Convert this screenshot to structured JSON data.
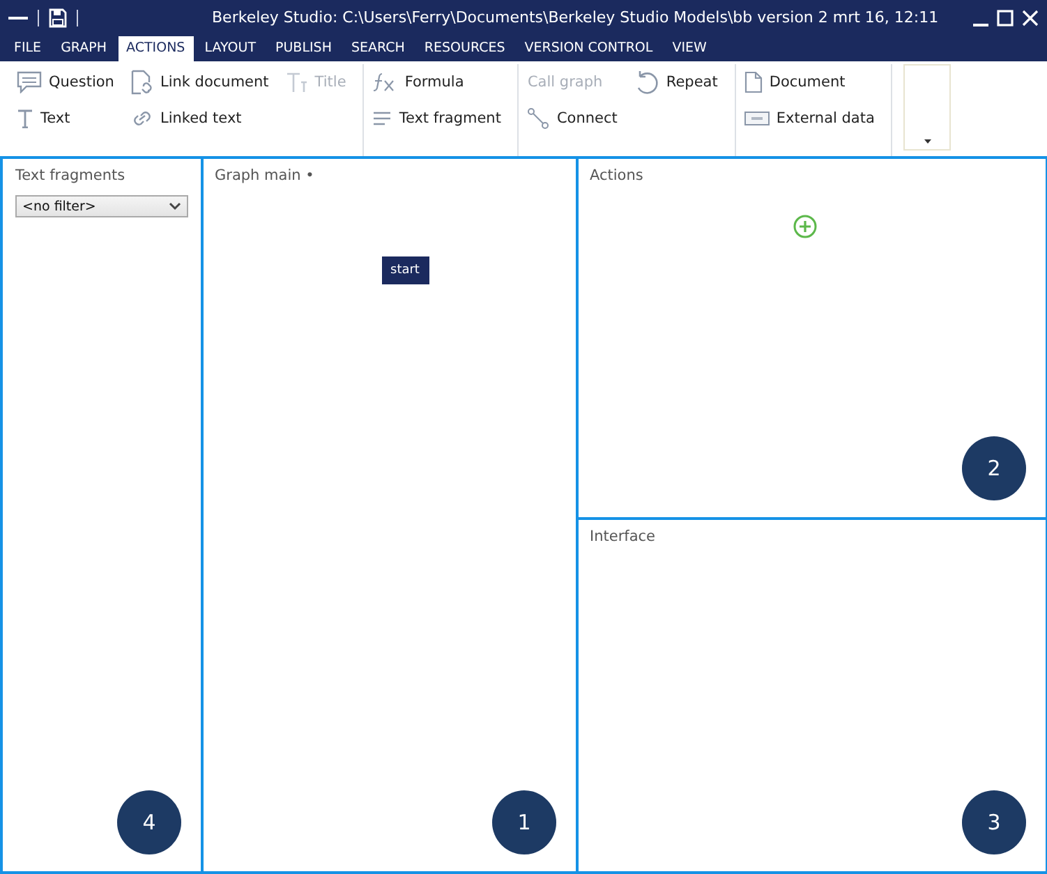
{
  "window": {
    "title": "Berkeley Studio: C:\\Users\\Ferry\\Documents\\Berkeley Studio Models\\bb version 2 mrt 16, 12:11"
  },
  "tabs": [
    {
      "label": "FILE",
      "selected": false
    },
    {
      "label": "GRAPH",
      "selected": false
    },
    {
      "label": "ACTIONS",
      "selected": true
    },
    {
      "label": "LAYOUT",
      "selected": false
    },
    {
      "label": "PUBLISH",
      "selected": false
    },
    {
      "label": "SEARCH",
      "selected": false
    },
    {
      "label": "RESOURCES",
      "selected": false
    },
    {
      "label": "VERSION CONTROL",
      "selected": false
    },
    {
      "label": "VIEW",
      "selected": false
    }
  ],
  "ribbon": {
    "groups": [
      {
        "rows": [
          [
            {
              "label": "Question",
              "disabled": false
            },
            {
              "label": "Link document",
              "disabled": false
            },
            {
              "label": "Title",
              "disabled": true
            }
          ],
          [
            {
              "label": "Text",
              "disabled": false
            },
            {
              "label": "Linked text",
              "disabled": false
            }
          ]
        ]
      },
      {
        "rows": [
          [
            {
              "label": "Formula",
              "disabled": false
            }
          ],
          [
            {
              "label": "Text fragment",
              "disabled": false
            }
          ]
        ]
      },
      {
        "rows": [
          [
            {
              "label": "Call graph",
              "disabled": true
            },
            {
              "label": "Repeat",
              "disabled": false
            }
          ],
          [
            {
              "label": "Connect",
              "disabled": false
            }
          ]
        ]
      },
      {
        "rows": [
          [
            {
              "label": "Document",
              "disabled": false
            }
          ],
          [
            {
              "label": "External data",
              "disabled": false
            }
          ]
        ]
      }
    ]
  },
  "panels": {
    "text_fragments": {
      "title": "Text fragments",
      "filter": "<no filter>",
      "badge": "4"
    },
    "graph": {
      "title": "Graph main •",
      "node": "start",
      "badge": "1"
    },
    "actions": {
      "title": "Actions",
      "badge": "2"
    },
    "interface": {
      "title": "Interface",
      "badge": "3"
    }
  }
}
